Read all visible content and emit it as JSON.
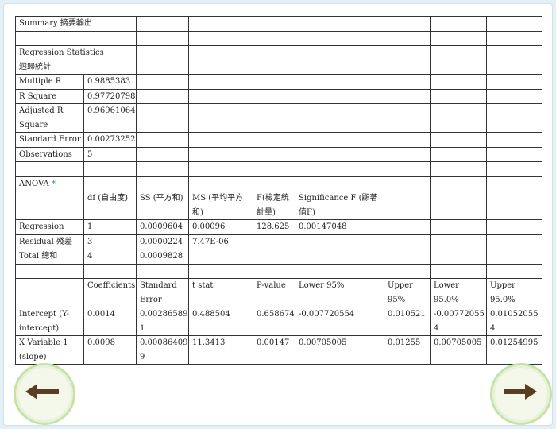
{
  "summary": {
    "title": "Summary 摘要輸出",
    "regression_stats_label": "Regression Statistics\n迴歸統計",
    "stats": [
      {
        "label": "Multiple R",
        "value": "0.9885383"
      },
      {
        "label": "R Square",
        "value": "0.97720798"
      },
      {
        "label": "Adjusted R Square",
        "value": "0.96961064"
      },
      {
        "label": "Standard Error",
        "value": "0.00273252"
      },
      {
        "label": "Observations",
        "value": "5"
      }
    ]
  },
  "anova": {
    "title": "ANOVA",
    "title_mark": "*",
    "headers": [
      "df (自由度)",
      "SS (平方和)",
      "MS (平均平方和)",
      "F(檢定統計量)",
      "Significance F (顯著值F)"
    ],
    "rows": [
      {
        "label": "Regression",
        "df": "1",
        "ss": "0.0009604",
        "ms": "0.00096",
        "f": "128.625",
        "sig": "0.00147048"
      },
      {
        "label": "Residual 殘差",
        "df": "3",
        "ss": "0.0000224",
        "ms": "7.47E-06",
        "f": "",
        "sig": ""
      },
      {
        "label": "Total 總和",
        "df": "4",
        "ss": "0.0009828",
        "ms": "",
        "f": "",
        "sig": ""
      }
    ]
  },
  "coefficients": {
    "headers": [
      "Coefficients",
      "Standard Error",
      "t stat",
      "P-value",
      "Lower 95%",
      "Upper 95%",
      "Lower 95.0%",
      "Upper 95.0%"
    ],
    "rows": [
      {
        "label": "Intercept (Y-intercept)",
        "values": [
          "0.0014",
          "0.002865891",
          "0.488504",
          "0.658674",
          "-0.007720554",
          "0.010521",
          "-0.007720554",
          "0.010520554"
        ]
      },
      {
        "label": "X Variable 1 (slope)",
        "values": [
          "0.0098",
          "0.000864099",
          "11.3413",
          "0.00147",
          "0.00705005",
          "0.01255",
          "0.00705005",
          "0.01254995"
        ]
      }
    ]
  },
  "nav": {
    "prev_icon": "arrow-left-icon",
    "next_icon": "arrow-right-icon",
    "arrow_color": "#5c3d24",
    "ring_color": "#c7e2a6"
  }
}
